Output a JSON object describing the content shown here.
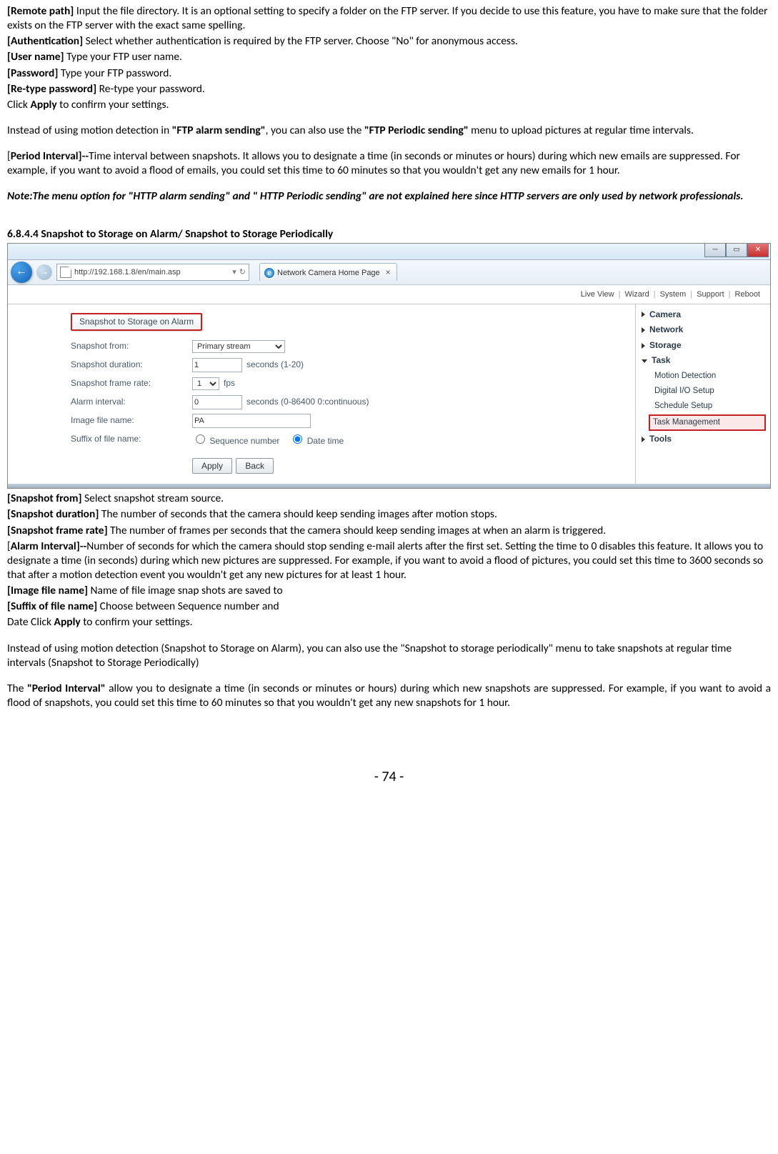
{
  "doc": {
    "p1_label": "[Remote path]",
    "p1_text": " Input the file directory. It is an optional setting to specify a folder on the FTP server. If you decide to use this feature, you have to make sure that the folder exists on the FTP server with the exact same spelling.",
    "p2_label": "[Authentication]",
    "p2_text": " Select whether authentication is required by the FTP server. Choose \"No\" for anonymous access.",
    "p3_label": "[User name]",
    "p3_text": " Type your FTP user name.",
    "p4_label": "[Password]",
    "p4_text": " Type your FTP password.",
    "p5_label": "[Re-type password]",
    "p5_text": " Re-type your password.",
    "p6_pre": "Click ",
    "p6_bold": "Apply",
    "p6_post": " to confirm your settings.",
    "p7_pre": "Instead of using motion detection in ",
    "p7_b1": "\"FTP alarm sending\"",
    "p7_mid": ", you can also use the ",
    "p7_b2": "\"FTP Periodic sending\"",
    "p7_post": " menu to upload pictures at regular time intervals.",
    "p8_label": "[Period Interval]--",
    "p8_text": "Time interval between snapshots. It allows you to designate a time (in seconds or minutes or hours) during which new emails are suppressed. For example, if you want to avoid a flood of emails, you could set this time to 60 minutes so that you wouldn't get any new emails for 1 hour.",
    "note": "Note:The menu option for \"HTTP alarm sending\" and \" HTTP Periodic sending\" are not explained here since HTTP servers are only used by network professionals.",
    "heading": "6.8.4.4 Snapshot to Storage on Alarm/ Snapshot to Storage Periodically",
    "q1_label": "[Snapshot from]",
    "q1_text": " Select snapshot stream source.",
    "q2_label": "[Snapshot duration]",
    "q2_text": " The number of seconds that the camera should keep sending images after motion stops.",
    "q3_label": "[Snapshot frame rate]",
    "q3_text": " The number of frames per seconds that the camera should keep sending images at when an alarm is triggered.",
    "q4_label": "[Alarm Interval]--",
    "q4_text": "Number of seconds for which the camera should stop sending e-mail alerts after the first set. Setting the time to 0 disables this feature. It allows you to designate a time (in seconds) during which new pictures are suppressed. For example, if you want to avoid a flood of pictures, you could set this time to 3600 seconds so that after a motion detection event you wouldn't get any new pictures for at least 1 hour.",
    "q5_label": "[Image file name]",
    "q5_text": " Name of file image snap shots are saved to",
    "q6_label": "[Suffix of file name]",
    "q6_text": " Choose between Sequence number and",
    "q7_pre": "Date Click ",
    "q7_bold": "Apply",
    "q7_post": " to confirm your settings.",
    "q8": "Instead of using motion detection (Snapshot to Storage on Alarm), you can also use the \"Snapshot to storage periodically\" menu to take snapshots at regular time intervals (Snapshot to Storage Periodically)",
    "q9_pre": "The ",
    "q9_bold": "\"Period Interval\"",
    "q9_post": " allow you to designate a time (in seconds or minutes or hours) during which new snapshots are suppressed. For example, if you want to avoid a flood of snapshots, you could set this time to 60 minutes so that you wouldn't get any new snapshots for 1 hour.",
    "page_num": "- 74 -"
  },
  "shot": {
    "url": "http://192.168.1.8/en/main.asp",
    "tab_title": "Network Camera Home Page",
    "topnav": [
      "Live View",
      "Wizard",
      "System",
      "Support",
      "Reboot"
    ],
    "panel_title": "Snapshot to Storage on Alarm",
    "form": {
      "snapshot_from_label": "Snapshot from:",
      "snapshot_from_value": "Primary stream",
      "duration_label": "Snapshot duration:",
      "duration_value": "1",
      "duration_hint": "seconds (1-20)",
      "framerate_label": "Snapshot frame rate:",
      "framerate_value": "1",
      "framerate_hint": "fps",
      "alarm_interval_label": "Alarm interval:",
      "alarm_interval_value": "0",
      "alarm_interval_hint": "seconds (0-86400 0:continuous)",
      "filename_label": "Image file name:",
      "filename_value": "PA",
      "suffix_label": "Suffix of file name:",
      "suffix_opt1": "Sequence number",
      "suffix_opt2": "Date time",
      "apply": "Apply",
      "back": "Back"
    },
    "side": {
      "camera": "Camera",
      "network": "Network",
      "storage": "Storage",
      "task": "Task",
      "motion": "Motion Detection",
      "digital": "Digital I/O Setup",
      "schedule": "Schedule Setup",
      "taskmgmt": "Task Management",
      "tools": "Tools"
    }
  }
}
